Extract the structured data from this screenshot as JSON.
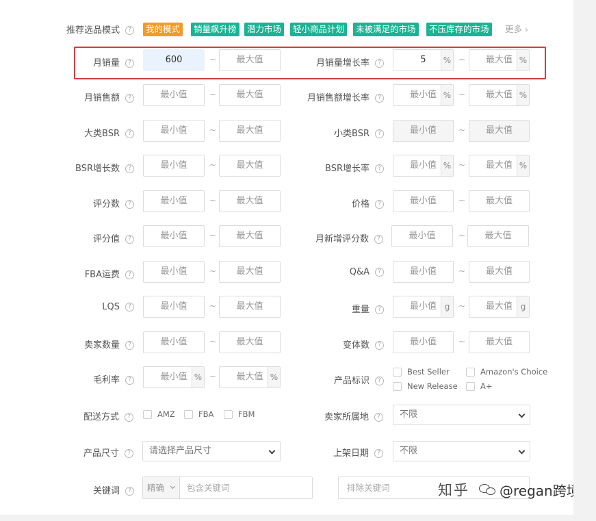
{
  "modes": {
    "label": "推荐选品模式",
    "chips": [
      {
        "text": "我的模式",
        "color": "#f59a23"
      },
      {
        "text": "销量飙升榜",
        "color": "#1bb394"
      },
      {
        "text": "潜力市场",
        "color": "#1bb394"
      },
      {
        "text": "轻小商品计划",
        "color": "#1bb394"
      },
      {
        "text": "未被满足的市场",
        "color": "#1bb394"
      },
      {
        "text": "不压库存的市场",
        "color": "#1bb394"
      }
    ],
    "more": "更多"
  },
  "placeholders": {
    "min": "最小值",
    "max": "最大值"
  },
  "left_rows": [
    {
      "label": "月销量",
      "min": "600",
      "max": "",
      "suffix": ""
    },
    {
      "label": "月销售额",
      "min": "",
      "max": "",
      "suffix": ""
    },
    {
      "label": "大类BSR",
      "min": "",
      "max": "",
      "suffix": ""
    },
    {
      "label": "BSR增长数",
      "min": "",
      "max": "",
      "suffix": ""
    },
    {
      "label": "评分数",
      "min": "",
      "max": "",
      "suffix": ""
    },
    {
      "label": "评分值",
      "min": "",
      "max": "",
      "suffix": ""
    },
    {
      "label": "FBA运费",
      "min": "",
      "max": "",
      "suffix": ""
    },
    {
      "label": "LQS",
      "min": "",
      "max": "",
      "suffix": ""
    },
    {
      "label": "卖家数量",
      "min": "",
      "max": "",
      "suffix": ""
    },
    {
      "label": "毛利率",
      "min": "",
      "max": "",
      "suffix": "%"
    }
  ],
  "right_rows": [
    {
      "label": "月销量增长率",
      "min": "5",
      "max": "",
      "suffix": "%"
    },
    {
      "label": "月销售额增长率",
      "min": "",
      "max": "",
      "suffix": "%"
    },
    {
      "label": "小类BSR",
      "min": "",
      "max": "",
      "suffix": ""
    },
    {
      "label": "BSR增长率",
      "min": "",
      "max": "",
      "suffix": "%"
    },
    {
      "label": "价格",
      "min": "",
      "max": "",
      "suffix": ""
    },
    {
      "label": "月新增评分数",
      "min": "",
      "max": "",
      "suffix": ""
    },
    {
      "label": "Q&A",
      "min": "",
      "max": "",
      "suffix": ""
    },
    {
      "label": "重量",
      "min": "",
      "max": "",
      "suffix": "g"
    },
    {
      "label": "变体数",
      "min": "",
      "max": "",
      "suffix": ""
    }
  ],
  "product_badge": {
    "label": "产品标识",
    "options": [
      "Best Seller",
      "Amazon's Choice",
      "New Release",
      "A+"
    ]
  },
  "delivery": {
    "label": "配送方式",
    "options": [
      "AMZ",
      "FBA",
      "FBM"
    ]
  },
  "seller_location": {
    "label": "卖家所属地",
    "value": "不限"
  },
  "product_size": {
    "label": "产品尺寸",
    "placeholder": "请选择产品尺寸"
  },
  "listing_date": {
    "label": "上架日期",
    "value": "不限"
  },
  "keywords": {
    "label": "关键词",
    "mode": "精确",
    "include_placeholder": "包含关键词",
    "exclude_placeholder": "排除关键词"
  },
  "watermark": {
    "logo": "知乎",
    "text": "@regan跨境"
  }
}
